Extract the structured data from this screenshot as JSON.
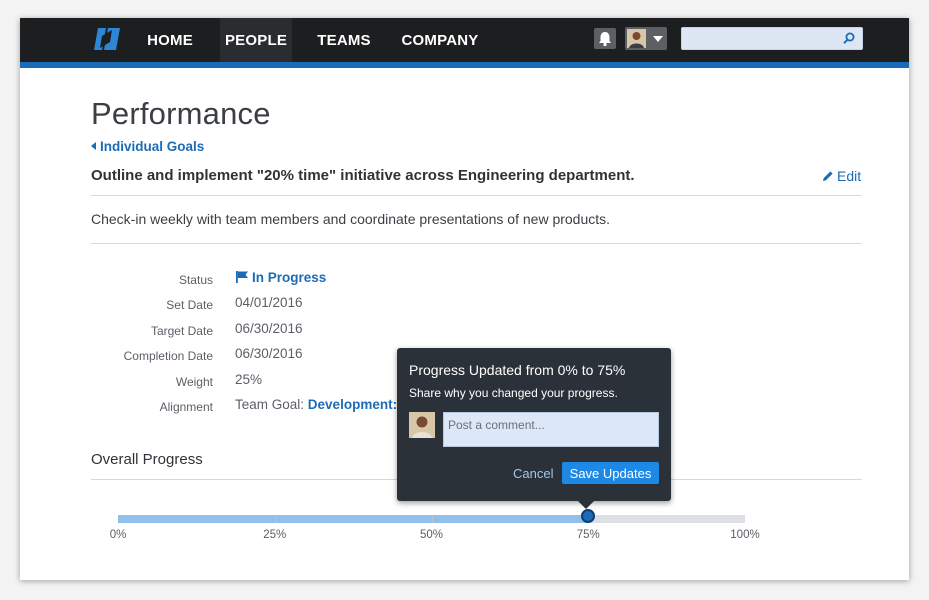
{
  "nav": {
    "items": [
      {
        "label": "HOME"
      },
      {
        "label": "PEOPLE"
      },
      {
        "label": "TEAMS"
      },
      {
        "label": "COMPANY"
      }
    ],
    "active": "PEOPLE",
    "search_placeholder": ""
  },
  "page": {
    "title": "Performance",
    "back_link": "Individual Goals",
    "goal_title": "Outline and implement \"20% time\" initiative across Engineering department.",
    "edit_label": "Edit",
    "goal_description": "Check-in weekly with team members and coordinate presentations of new products."
  },
  "fields": [
    {
      "label": "Status",
      "value": "In Progress"
    },
    {
      "label": "Set Date",
      "value": "04/01/2016"
    },
    {
      "label": "Target Date",
      "value": "06/30/2016"
    },
    {
      "label": "Completion Date",
      "value": "06/30/2016"
    },
    {
      "label": "Weight",
      "value": "25%"
    },
    {
      "label": "Alignment",
      "value_prefix": "Team Goal:",
      "value_link": "Development:"
    }
  ],
  "progress": {
    "heading": "Overall Progress",
    "value_fraction": 0.75,
    "tick_labels": [
      "0%",
      "25%",
      "50%",
      "75%",
      "100%"
    ]
  },
  "popover": {
    "title": "Progress Updated from 0% to 75%",
    "subtitle": "Share why you changed your progress.",
    "comment_placeholder": "Post a comment...",
    "cancel_label": "Cancel",
    "save_label": "Save Updates"
  },
  "colors": {
    "nav_bg": "#1d1e20",
    "accent": "#1b6cb8",
    "link": "#1c6cb5",
    "popover_bg": "#2b3138",
    "save_button": "#1e88e5"
  },
  "icons": {
    "logo": "brand-logo-icon",
    "bell": "bell-icon",
    "search": "search-icon",
    "edit": "pencil-icon",
    "status": "flag-icon",
    "back": "chevron-left-icon"
  }
}
